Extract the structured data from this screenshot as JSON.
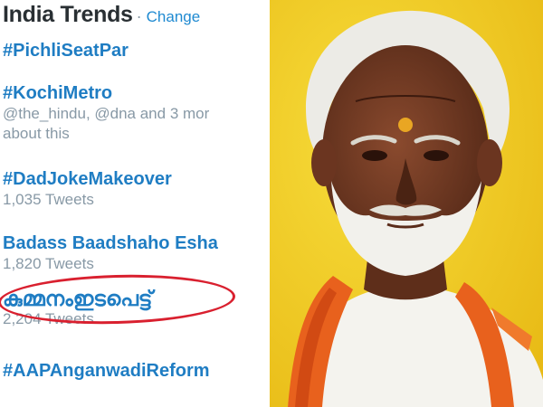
{
  "trends": {
    "title": "India Trends",
    "separator": "·",
    "change_label": "Change",
    "items": [
      {
        "name": "#PichliSeatPar"
      },
      {
        "name": "#KochiMetro",
        "meta_line1": "@the_hindu, @dna and 3 mor",
        "meta_line2": "about this"
      },
      {
        "name": "#DadJokeMakeover",
        "meta_line1": "1,035 Tweets"
      },
      {
        "name": "Badass Baadshaho Esha",
        "meta_line1": "1,820 Tweets"
      },
      {
        "name": "കുമ്മനംഇടപെട്ട്",
        "meta_line1": "2,204 Tweets"
      },
      {
        "name": "#AAPAnganwadiReform"
      }
    ]
  },
  "colors": {
    "trend_link": "#1f7dc3",
    "meta_gray": "#8899a6",
    "highlight_oval": "#d9202f",
    "photo_background": "#f2d21b",
    "saffron_shawl": "#e8611d"
  }
}
